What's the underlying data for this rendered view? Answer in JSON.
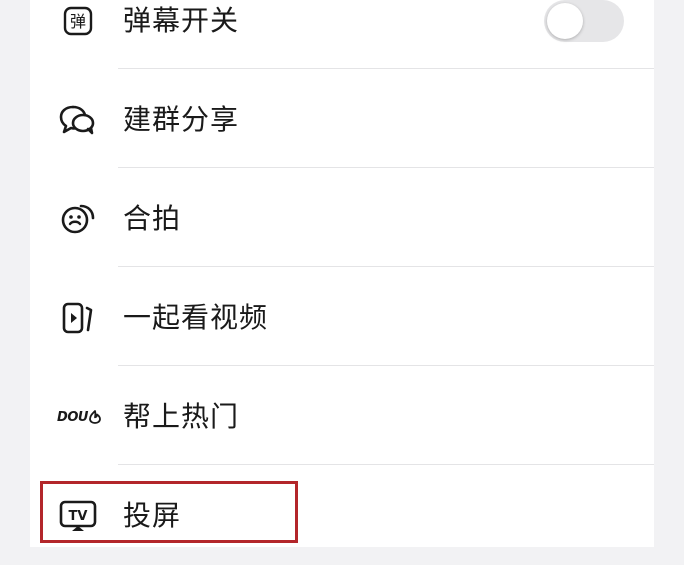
{
  "menu": {
    "items": [
      {
        "id": "danmaku",
        "label": "弹幕开关",
        "icon": "danmaku-icon",
        "icon_glyph": "弹",
        "toggle": {
          "on": false
        }
      },
      {
        "id": "group-share",
        "label": "建群分享",
        "icon": "chat-bubbles-icon"
      },
      {
        "id": "duet",
        "label": "合拍",
        "icon": "duet-face-icon"
      },
      {
        "id": "watch-together",
        "label": "一起看视频",
        "icon": "watch-together-icon"
      },
      {
        "id": "dou-plus",
        "label": "帮上热门",
        "icon": "dou-plus-icon",
        "icon_text": "DOU"
      },
      {
        "id": "cast-screen",
        "label": "投屏",
        "icon": "tv-cast-icon",
        "icon_text": "TV",
        "highlighted": true
      }
    ]
  },
  "colors": {
    "background": "#f2f2f4",
    "panel": "#ffffff",
    "text": "#1a1a1a",
    "divider": "#e4e4e6",
    "toggle_off": "#e6e6e8",
    "highlight_border": "#b3262a"
  }
}
